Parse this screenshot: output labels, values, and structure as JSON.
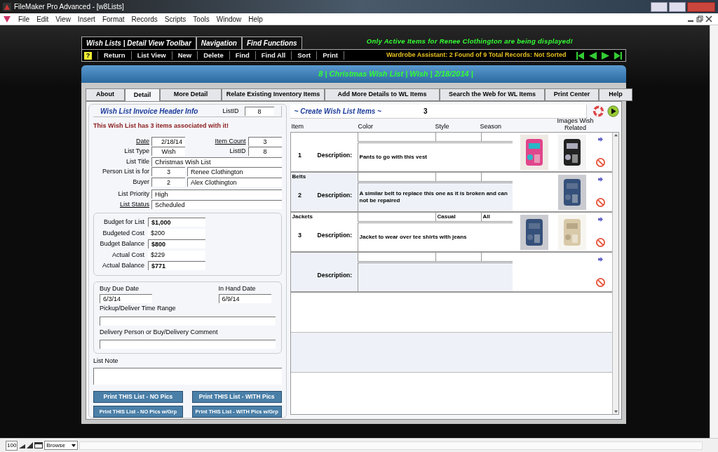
{
  "window": {
    "title": "FileMaker Pro Advanced - [w8Lists]",
    "menu": [
      "File",
      "Edit",
      "View",
      "Insert",
      "Format",
      "Records",
      "Scripts",
      "Tools",
      "Window",
      "Help"
    ]
  },
  "toolbar": {
    "tabs": [
      {
        "label": "Wish Lists | Detail View Toolbar",
        "selected": true
      },
      {
        "label": "Navigation",
        "selected": false
      },
      {
        "label": "Find Functions",
        "selected": false
      }
    ],
    "help_key": "?",
    "buttons": [
      "Return",
      "List View",
      "New",
      "Delete",
      "Find",
      "Find All",
      "Sort",
      "Print"
    ],
    "notice": "Only Active Items for Renee Clothington are being displayed!",
    "record_status": "Wardrobe Assistant:  2 Found of 9 Total Records: Not Sorted"
  },
  "header_band": "8  |  Christmas Wish List  |  Wish  |  2/18/2014  |",
  "layout_tabs": [
    {
      "label": "About",
      "selected": false
    },
    {
      "label": "Detail",
      "selected": true
    },
    {
      "label": "More Detail",
      "selected": false
    },
    {
      "label": "Relate Existing Inventory Items",
      "selected": false
    },
    {
      "label": "Add More Details to WL Items",
      "selected": false
    },
    {
      "label": "Search the Web for WL Items",
      "selected": false
    },
    {
      "label": "Print Center",
      "selected": false
    },
    {
      "label": "Help",
      "selected": false
    }
  ],
  "header_info": {
    "title": "Wish List Invoice Header Info",
    "listid_label": "ListID",
    "listid_value": "8",
    "message": "This Wish List has 3 items associated with it!",
    "date": {
      "label": "Date",
      "value": "2/18/14",
      "link": true
    },
    "item_count": {
      "label": "Item Count",
      "value": "3",
      "link": true
    },
    "list_type": {
      "label": "List Type",
      "value": "Wish",
      "link": false
    },
    "list_id": {
      "label": "ListID",
      "value": "8",
      "link": false
    },
    "list_title": {
      "label": "List Title",
      "value": "Christmas Wish List",
      "link": false
    },
    "person": {
      "label": "Person List is for",
      "id": "3",
      "name": "Renee Clothington",
      "link": false
    },
    "buyer": {
      "label": "Buyer",
      "id": "2",
      "name": "Alex Clothington",
      "link": false
    },
    "priority": {
      "label": "List Priority",
      "value": "High",
      "link": false
    },
    "status": {
      "label": "List Status",
      "value": "Scheduled",
      "link": true
    }
  },
  "budget": [
    {
      "label": "Budget for List",
      "value": "$1,000",
      "bold": true
    },
    {
      "label": "Budgeted Cost",
      "value": "$200",
      "bold": false
    },
    {
      "label": "Budget Balance",
      "value": "$800",
      "bold": true
    },
    {
      "label": "Actual Cost",
      "value": "$229",
      "bold": false
    },
    {
      "label": "Actual Balance",
      "value": "$771",
      "bold": true
    }
  ],
  "dates": {
    "buy_due": {
      "label": "Buy Due Date",
      "value": "6/3/14"
    },
    "in_hand": {
      "label": "In Hand Date",
      "value": "6/9/14"
    },
    "pickup_label": "Pickup/Deliver Time Range",
    "delivery_label": "Delivery Person or Buy/Delivery Comment",
    "note_label": "List Note"
  },
  "print_buttons": [
    "Print THIS List  - NO Pics",
    "Print THIS List  - WITH Pics",
    "Print THIS List  - NO Pics w/Grp",
    "Print THIS List  - WITH Pics  w/Grp"
  ],
  "items": {
    "title": "~ Create Wish List Items  ~",
    "count": "3",
    "columns": [
      "Item",
      "Color",
      "Style",
      "Season",
      "Images Wish Related"
    ],
    "rows": [
      {
        "category": "",
        "number": "1",
        "description_label": "Description:",
        "description": "Pants to go with this vest",
        "color": "",
        "style": "",
        "season": "",
        "images": [
          {
            "kind": "picture"
          },
          {
            "kind": "picture"
          }
        ]
      },
      {
        "category": "Belts",
        "number": "2",
        "description_label": "Description:",
        "description": "A similar belt to replace this one as it is broken and can not be repaired",
        "color": "",
        "style": "",
        "season": "",
        "images": [
          {
            "kind": "none"
          },
          {
            "kind": "picture"
          }
        ]
      },
      {
        "category": "Jackets",
        "number": "3",
        "description_label": "Description:",
        "description": "Jacket to wear over tee shirts with jeans",
        "color": "",
        "style": "Casual",
        "season": "All",
        "images": [
          {
            "kind": "picture"
          },
          {
            "kind": "picture"
          }
        ]
      },
      {
        "category": "",
        "number": "",
        "description_label": "Description:",
        "description": "",
        "color": "",
        "style": "",
        "season": "",
        "images": [
          {
            "kind": "none"
          },
          {
            "kind": "none"
          }
        ]
      }
    ]
  },
  "status_bar": {
    "zoom": "100",
    "mode": "Browse"
  }
}
